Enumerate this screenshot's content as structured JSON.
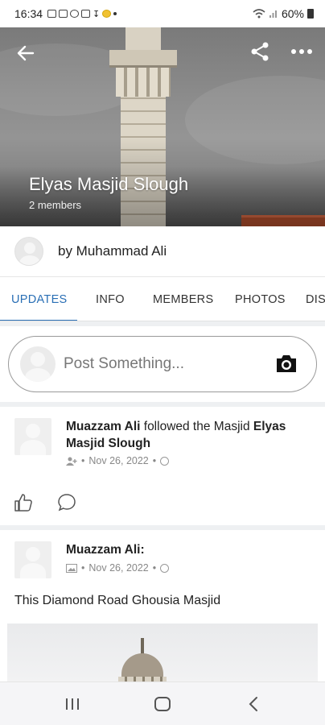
{
  "status_bar": {
    "time": "16:34",
    "battery": "60%",
    "icons": [
      "gallery-icon",
      "voicemail-icon",
      "circle-icon",
      "message-icon",
      "download-icon",
      "emoji-icon",
      "dot-icon",
      "wifi-icon",
      "signal-icon",
      "battery-icon"
    ]
  },
  "header": {
    "title": "Elyas Masjid Slough",
    "members": "2 members",
    "icons": {
      "back": "arrow-left-icon",
      "share": "share-icon",
      "more": "more-horizontal-icon"
    }
  },
  "author": {
    "text": "by Muhammad Ali"
  },
  "tabs": [
    {
      "label": "UPDATES",
      "active": true
    },
    {
      "label": "INFO",
      "active": false
    },
    {
      "label": "MEMBERS",
      "active": false
    },
    {
      "label": "PHOTOS",
      "active": false
    },
    {
      "label": "DIS",
      "active": false
    }
  ],
  "composer": {
    "placeholder": "Post Something..."
  },
  "posts": [
    {
      "actor": "Muazzam Ali",
      "action": " followed the Masjid ",
      "target": "Elyas Masjid Slough",
      "date": "Nov 26, 2022",
      "meta_icon": "person-add-icon",
      "separator": "•"
    },
    {
      "actor": "Muazzam Ali:",
      "date": "Nov 26, 2022",
      "meta_icon": "image-icon",
      "separator": "•",
      "body": "This Diamond Road Ghousia Masjid"
    }
  ],
  "colors": {
    "accent": "#2a6fb5",
    "feed_bg": "#eef0f2"
  }
}
